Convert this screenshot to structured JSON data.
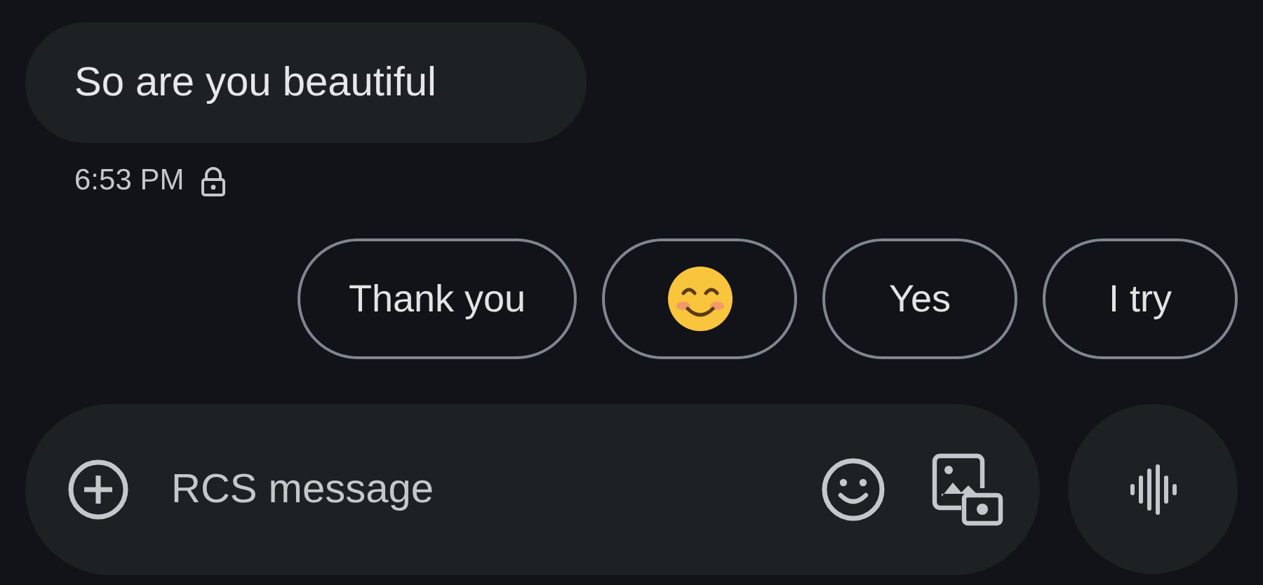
{
  "message": {
    "text": "So are you beautiful",
    "time": "6:53 PM",
    "encrypted": true
  },
  "suggestions": [
    {
      "kind": "text",
      "label": "Thank you"
    },
    {
      "kind": "emoji"
    },
    {
      "kind": "text",
      "label": "Yes"
    },
    {
      "kind": "text",
      "label": "I try"
    }
  ],
  "composer": {
    "placeholder": "RCS message"
  }
}
